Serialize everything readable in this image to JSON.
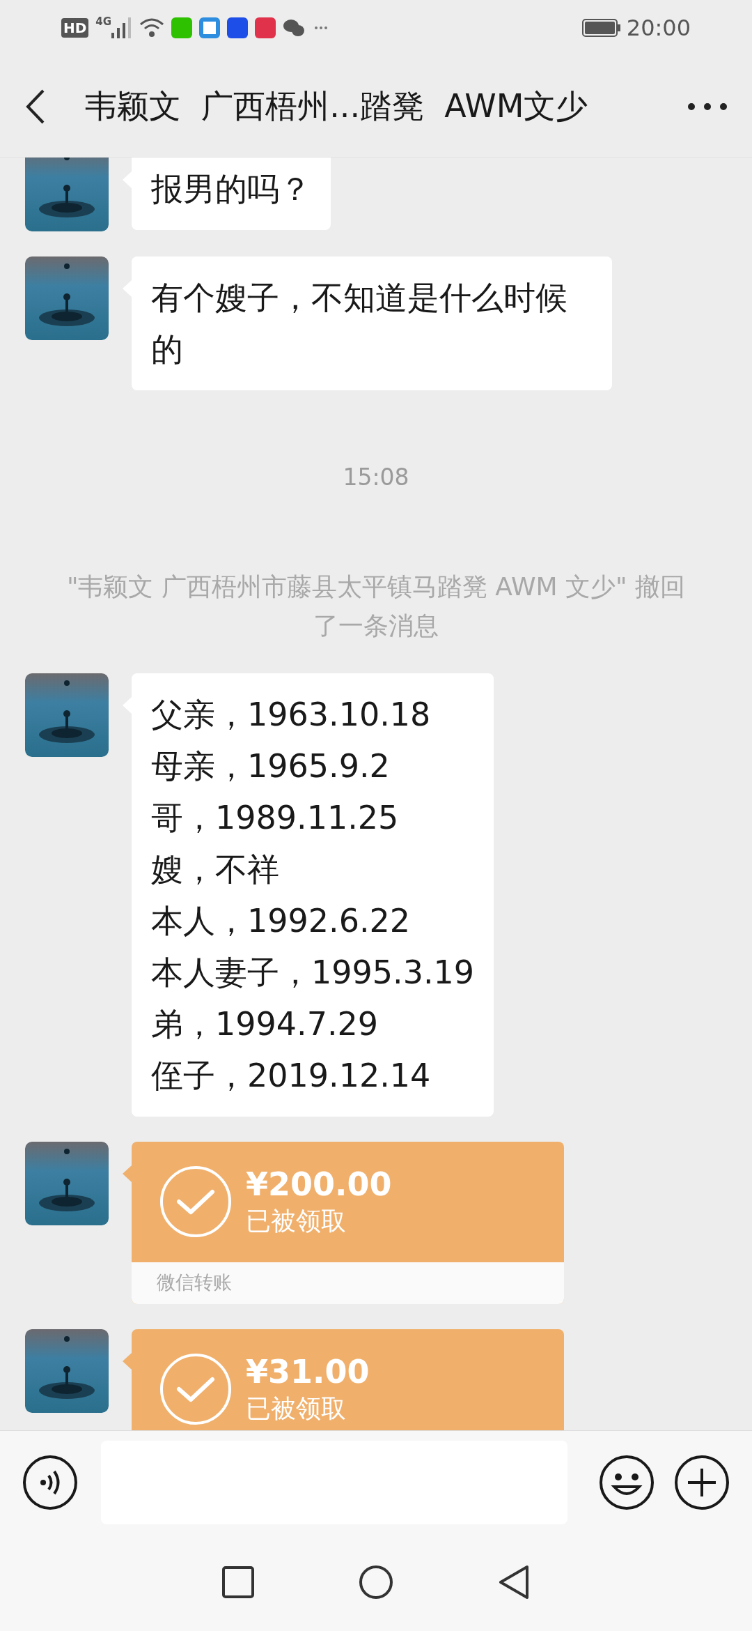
{
  "status_bar": {
    "hd": "HD",
    "network": "4G",
    "time": "20:00"
  },
  "header": {
    "title": "韦颖文  广西梧州...踏凳  AWM文少"
  },
  "messages": [
    {
      "kind": "text",
      "lines": [
        "报男的吗？"
      ]
    },
    {
      "kind": "text",
      "lines": [
        "有个嫂子，不知道是什么时候的"
      ]
    },
    {
      "kind": "time",
      "text": "15:08"
    },
    {
      "kind": "system",
      "text": "\"韦颖文  广西梧州市藤县太平镇马踏凳  AWM 文少\" 撤回了一条消息"
    },
    {
      "kind": "text",
      "lines": [
        "父亲，1963.10.18",
        "母亲，1965.9.2",
        "哥，1989.11.25",
        "嫂，不祥",
        "本人，1992.6.22",
        "本人妻子，1995.3.19",
        "弟，1994.7.29",
        "侄子，2019.12.14"
      ]
    },
    {
      "kind": "transfer",
      "amount": "¥200.00",
      "status": "已被领取",
      "footer": "微信转账"
    },
    {
      "kind": "transfer",
      "amount": "¥31.00",
      "status": "已被领取"
    }
  ]
}
